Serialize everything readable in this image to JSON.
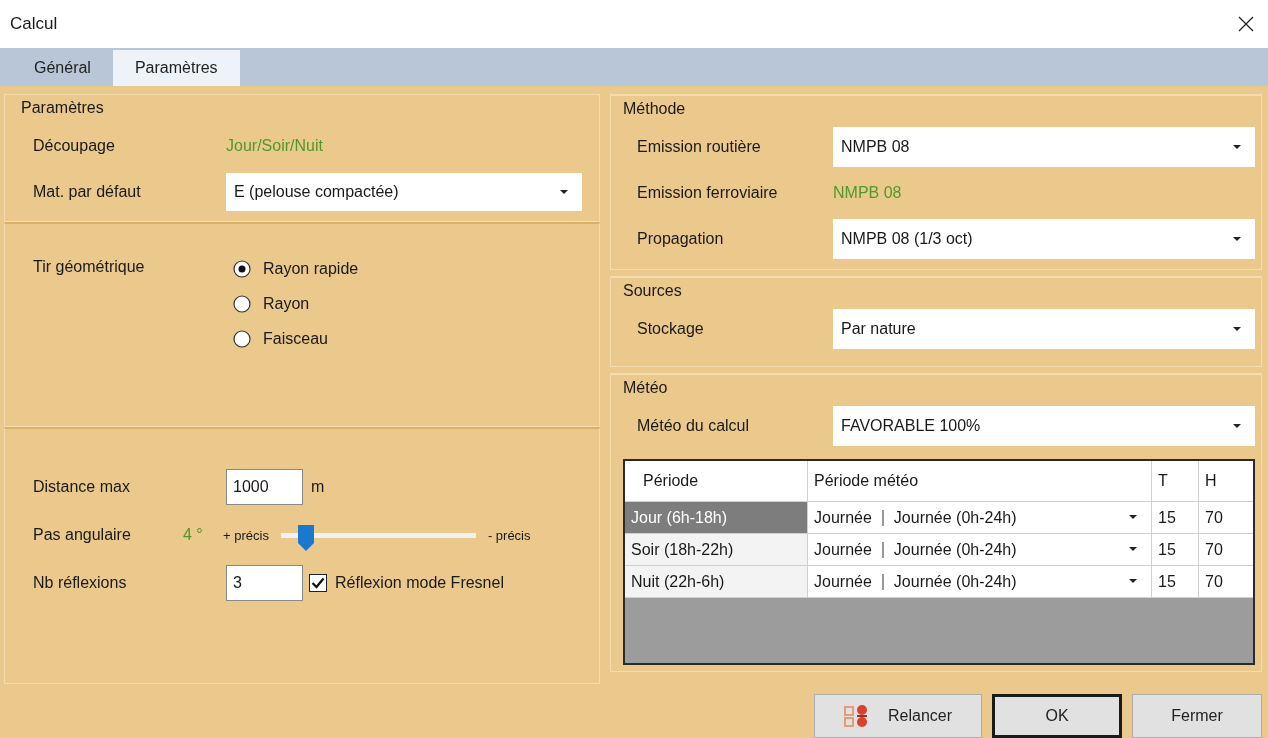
{
  "window": {
    "title": "Calcul"
  },
  "tabs": [
    {
      "label": "Général",
      "selected": false
    },
    {
      "label": "Paramètres",
      "selected": true
    }
  ],
  "parametres": {
    "title": "Paramètres",
    "rows": [
      {
        "kind": "value",
        "label": "Découpage",
        "value": "Jour/Soir/Nuit"
      },
      {
        "kind": "combo",
        "label": "Mat. par défaut",
        "value": "E (pelouse compactée)"
      }
    ]
  },
  "tir": {
    "label": "Tir géométrique",
    "options": [
      {
        "label": "Rayon rapide",
        "selected": true
      },
      {
        "label": "Rayon",
        "selected": false
      },
      {
        "label": "Faisceau",
        "selected": false
      }
    ]
  },
  "distance": {
    "label": "Distance max",
    "value": "1000",
    "unit": "m"
  },
  "pas": {
    "label": "Pas angulaire",
    "value": "4 °",
    "min_label": "+ précis",
    "max_label": "- précis",
    "level": 0.13
  },
  "reflexions": {
    "label": "Nb réflexions",
    "value": "3",
    "checkbox": {
      "label": "Réflexion mode Fresnel",
      "checked": true
    }
  },
  "sections": [
    {
      "title": "Méthode",
      "rows": [
        {
          "kind": "combo",
          "label": "Emission routière",
          "value": "NMPB 08"
        },
        {
          "kind": "value",
          "label": "Emission ferroviaire",
          "value": "NMPB 08"
        },
        {
          "kind": "combo",
          "label": "Propagation",
          "value": "NMPB 08 (1/3 oct)"
        }
      ]
    },
    {
      "title": "Sources",
      "rows": [
        {
          "kind": "combo",
          "label": "Stockage",
          "value": "Par nature"
        }
      ]
    },
    {
      "title": "Météo",
      "rows": [
        {
          "kind": "combo",
          "label": "Météo du calcul",
          "value": "FAVORABLE 100%"
        }
      ]
    }
  ],
  "grid": {
    "columns": [
      "Période",
      "Période météo",
      "T",
      "H"
    ],
    "rows": [
      {
        "periode": "Jour (6h-18h)",
        "meteo": "Journée",
        "meteo_detail": "Journée (0h-24h)",
        "t": "15",
        "h": "70",
        "selected": true
      },
      {
        "periode": "Soir (18h-22h)",
        "meteo": "Journée",
        "meteo_detail": "Journée (0h-24h)",
        "t": "15",
        "h": "70",
        "selected": false
      },
      {
        "periode": "Nuit (22h-6h)",
        "meteo": "Journée",
        "meteo_detail": "Journée (0h-24h)",
        "t": "15",
        "h": "70",
        "selected": false
      }
    ]
  },
  "buttons": [
    {
      "label": "Relancer",
      "kind": "icon"
    },
    {
      "label": "OK",
      "kind": "default"
    },
    {
      "label": "Fermer",
      "kind": "plain"
    }
  ]
}
